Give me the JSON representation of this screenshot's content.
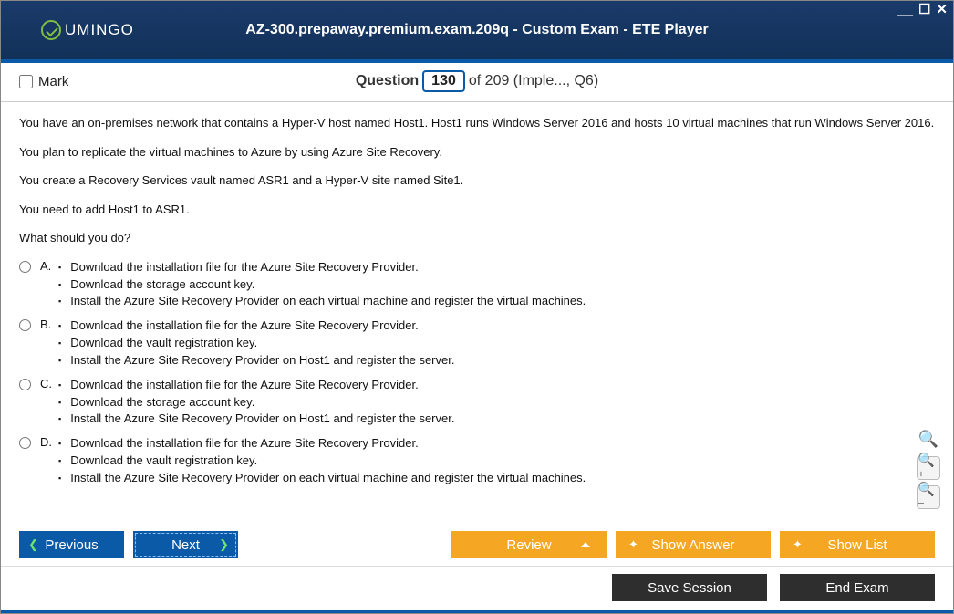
{
  "title": "AZ-300.prepaway.premium.exam.209q - Custom Exam - ETE Player",
  "logo_text": "UMINGO",
  "mark_label": "Mark",
  "question_label": "Question",
  "question_number": "130",
  "question_total_suffix": "of 209 (Imple..., Q6)",
  "paragraphs": [
    "You have an on-premises network that contains a Hyper-V host named Host1. Host1 runs Windows Server 2016 and hosts 10 virtual machines that run Windows Server 2016.",
    "You plan to replicate the virtual machines to Azure by using Azure Site Recovery.",
    "You create a Recovery Services vault named ASR1 and a Hyper-V site named Site1.",
    "You need to add Host1 to ASR1.",
    "What should you do?"
  ],
  "options": [
    {
      "letter": "A.",
      "lines": [
        "Download the installation file for the Azure Site Recovery Provider.",
        "Download the storage account key.",
        "Install the Azure Site Recovery Provider on each virtual machine and register the virtual machines."
      ]
    },
    {
      "letter": "B.",
      "lines": [
        "Download the installation file for the Azure Site Recovery Provider.",
        "Download the vault registration key.",
        "Install the Azure Site Recovery Provider on Host1 and register the server."
      ]
    },
    {
      "letter": "C.",
      "lines": [
        "Download the installation file for the Azure Site Recovery Provider.",
        "Download the storage account key.",
        "Install the Azure Site Recovery Provider on Host1 and register the server."
      ]
    },
    {
      "letter": "D.",
      "lines": [
        "Download the installation file for the Azure Site Recovery Provider.",
        "Download the vault registration key.",
        "Install the Azure Site Recovery Provider on each virtual machine and register the virtual machines."
      ]
    }
  ],
  "buttons": {
    "previous": "Previous",
    "next": "Next",
    "review": "Review",
    "show_answer": "Show Answer",
    "show_list": "Show List",
    "save_session": "Save Session",
    "end_exam": "End Exam"
  }
}
